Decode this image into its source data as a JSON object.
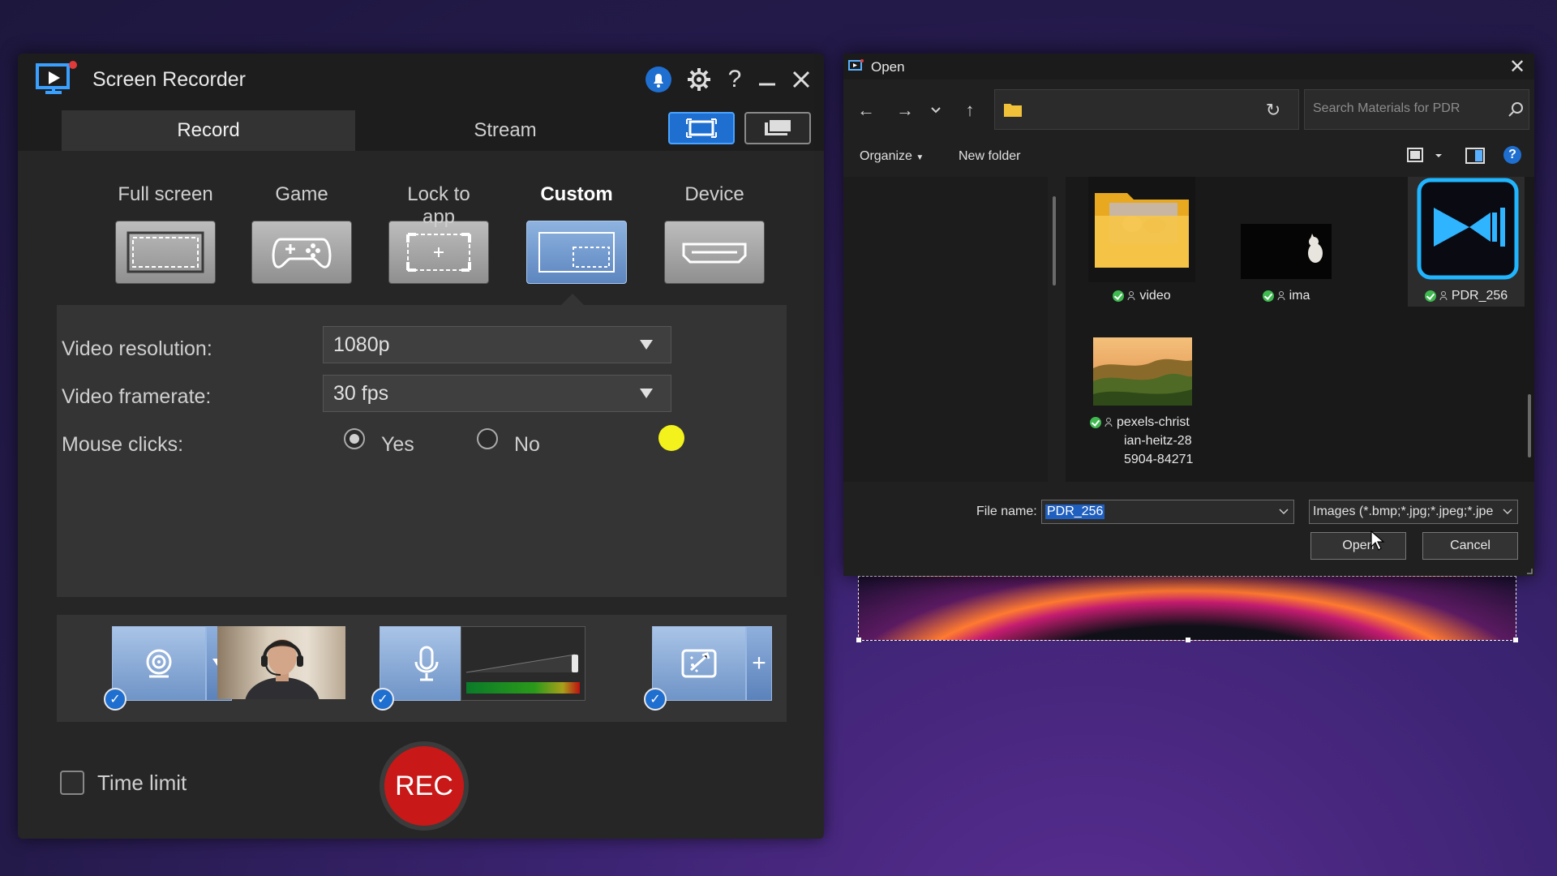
{
  "recorder": {
    "title": "Screen Recorder",
    "tabs": {
      "record": "Record",
      "stream": "Stream"
    },
    "modes": [
      "Full screen",
      "Game",
      "Lock to app",
      "Custom",
      "Device"
    ],
    "selected_mode": "Custom",
    "settings": {
      "resolution_label": "Video resolution:",
      "resolution_value": "1080p",
      "framerate_label": "Video framerate:",
      "framerate_value": "30 fps",
      "mouse_clicks_label": "Mouse clicks:",
      "yes_label": "Yes",
      "no_label": "No",
      "mouse_clicks_selected": "Yes",
      "click_color": "#f4f21c"
    },
    "devices": {
      "webcam_enabled": true,
      "mic_enabled": true,
      "effects_enabled": true
    },
    "time_limit_label": "Time limit",
    "time_limit_checked": false,
    "rec_label": "REC",
    "accent_color": "#1f6fd1",
    "rec_color": "#c81818"
  },
  "dialog": {
    "title": "Open",
    "search_placeholder": "Search Materials for PDR",
    "organize_label": "Organize",
    "new_folder_label": "New folder",
    "files": [
      {
        "name": "video",
        "type": "folder",
        "selected": false
      },
      {
        "name": "ima",
        "type": "image",
        "selected": false
      },
      {
        "name": "PDR_256",
        "type": "image",
        "selected": true
      },
      {
        "name_lines": [
          "pexels-christ",
          "ian-heitz-28",
          "5904-84271"
        ],
        "type": "image",
        "selected": false
      }
    ],
    "filename_label": "File name:",
    "filename_value": "PDR_256",
    "filetype_value": "Images (*.bmp;*.jpg;*.jpeg;*.jpe",
    "open_label": "Open",
    "cancel_label": "Cancel"
  }
}
